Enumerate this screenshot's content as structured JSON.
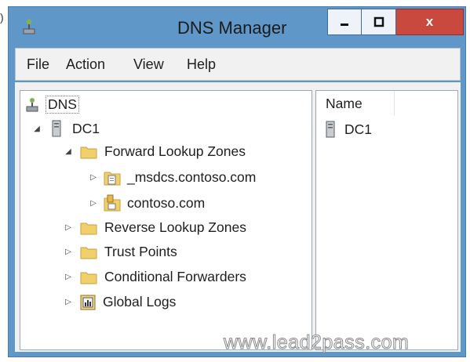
{
  "window": {
    "title": "DNS Manager",
    "close_label": "x",
    "edge_glyph": ")"
  },
  "menu": {
    "items": [
      "File",
      "Action",
      "View",
      "Help"
    ]
  },
  "tree": {
    "root": "DNS",
    "server": "DC1",
    "forward": "Forward Lookup Zones",
    "msdcs": "_msdcs.contoso.com",
    "contoso": "contoso.com",
    "reverse": "Reverse Lookup Zones",
    "trust": "Trust Points",
    "conditional": "Conditional Forwarders",
    "logs": "Global Logs"
  },
  "list": {
    "column_name": "Name",
    "items": [
      "DC1"
    ]
  },
  "watermark": "www.lead2pass.com",
  "colors": {
    "titlebar": "#5f97c9",
    "close_button": "#c9493f",
    "folder": "#f1cf6a"
  }
}
